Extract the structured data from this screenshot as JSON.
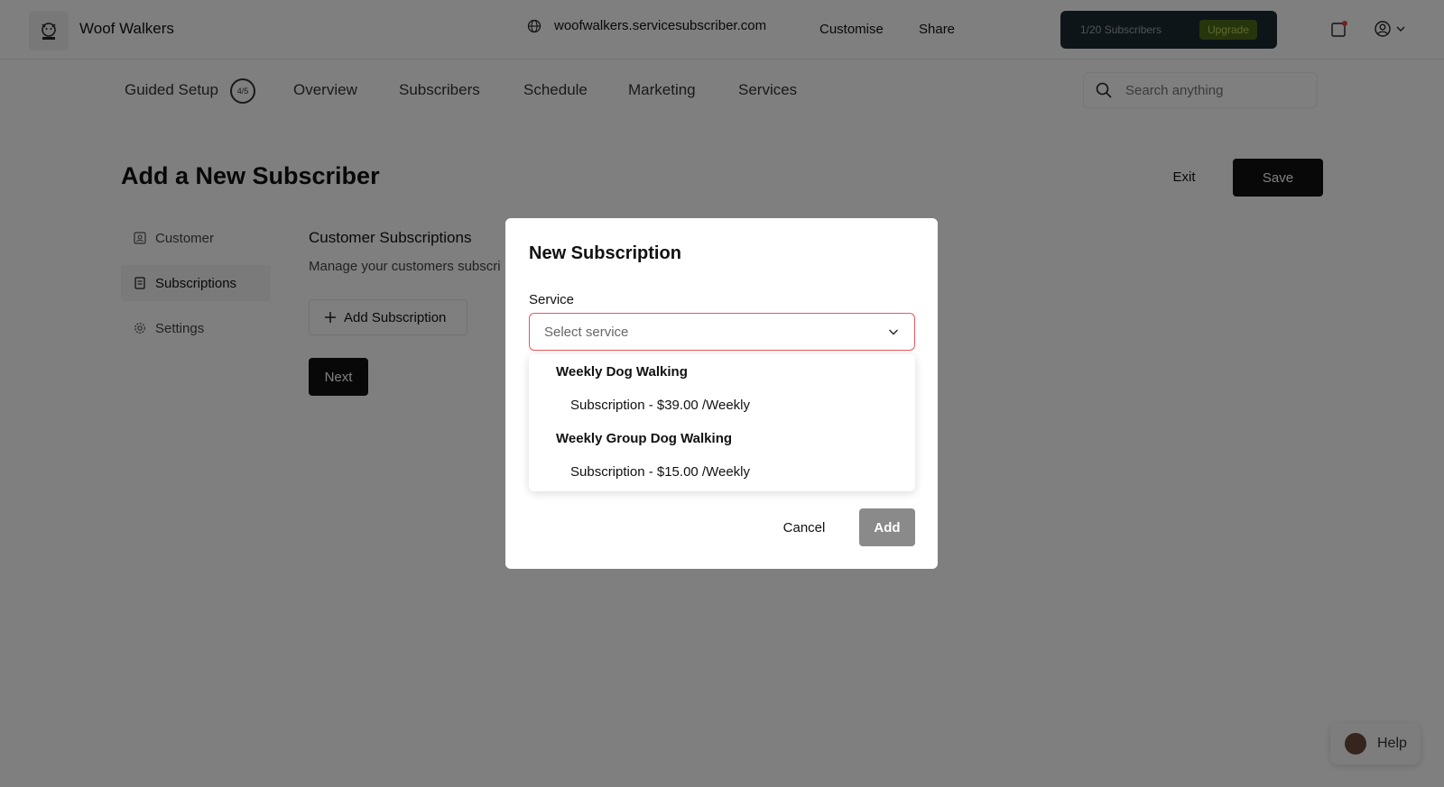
{
  "header": {
    "brand": "Woof Walkers",
    "domain": "woofwalkers.servicesubscriber.com",
    "customise": "Customise",
    "share": "Share",
    "plan_count": "1/20 Subscribers",
    "upgrade": "Upgrade"
  },
  "nav": {
    "guided_setup": "Guided Setup",
    "setup_progress": "4/5",
    "overview": "Overview",
    "subscribers": "Subscribers",
    "schedule": "Schedule",
    "marketing": "Marketing",
    "services": "Services",
    "search_placeholder": "Search anything"
  },
  "page": {
    "title": "Add a New Subscriber",
    "exit": "Exit",
    "save": "Save",
    "sidebar": [
      {
        "label": "Customer",
        "icon": "person-box-icon"
      },
      {
        "label": "Subscriptions",
        "icon": "document-icon"
      },
      {
        "label": "Settings",
        "icon": "gear-icon"
      }
    ],
    "section_title": "Customer Subscriptions",
    "section_subtitle": "Manage your customers subscri",
    "add_subscription": "Add Subscription",
    "next": "Next"
  },
  "help": "Help",
  "modal": {
    "title": "New Subscription",
    "service_label": "Service",
    "service_placeholder": "Select service",
    "groups": [
      {
        "name": "Weekly Dog Walking",
        "option": "Subscription - $39.00 /Weekly"
      },
      {
        "name": "Weekly Group Dog Walking",
        "option": "Subscription - $15.00 /Weekly"
      }
    ],
    "cancel": "Cancel",
    "add": "Add"
  },
  "colors": {
    "plan_bg": "#1d2a33",
    "upgrade_bg": "#4f6a1b",
    "upgrade_text": "#b8d45b",
    "select_border_error": "#e35a5a",
    "add_disabled": "#8a8a8a"
  }
}
